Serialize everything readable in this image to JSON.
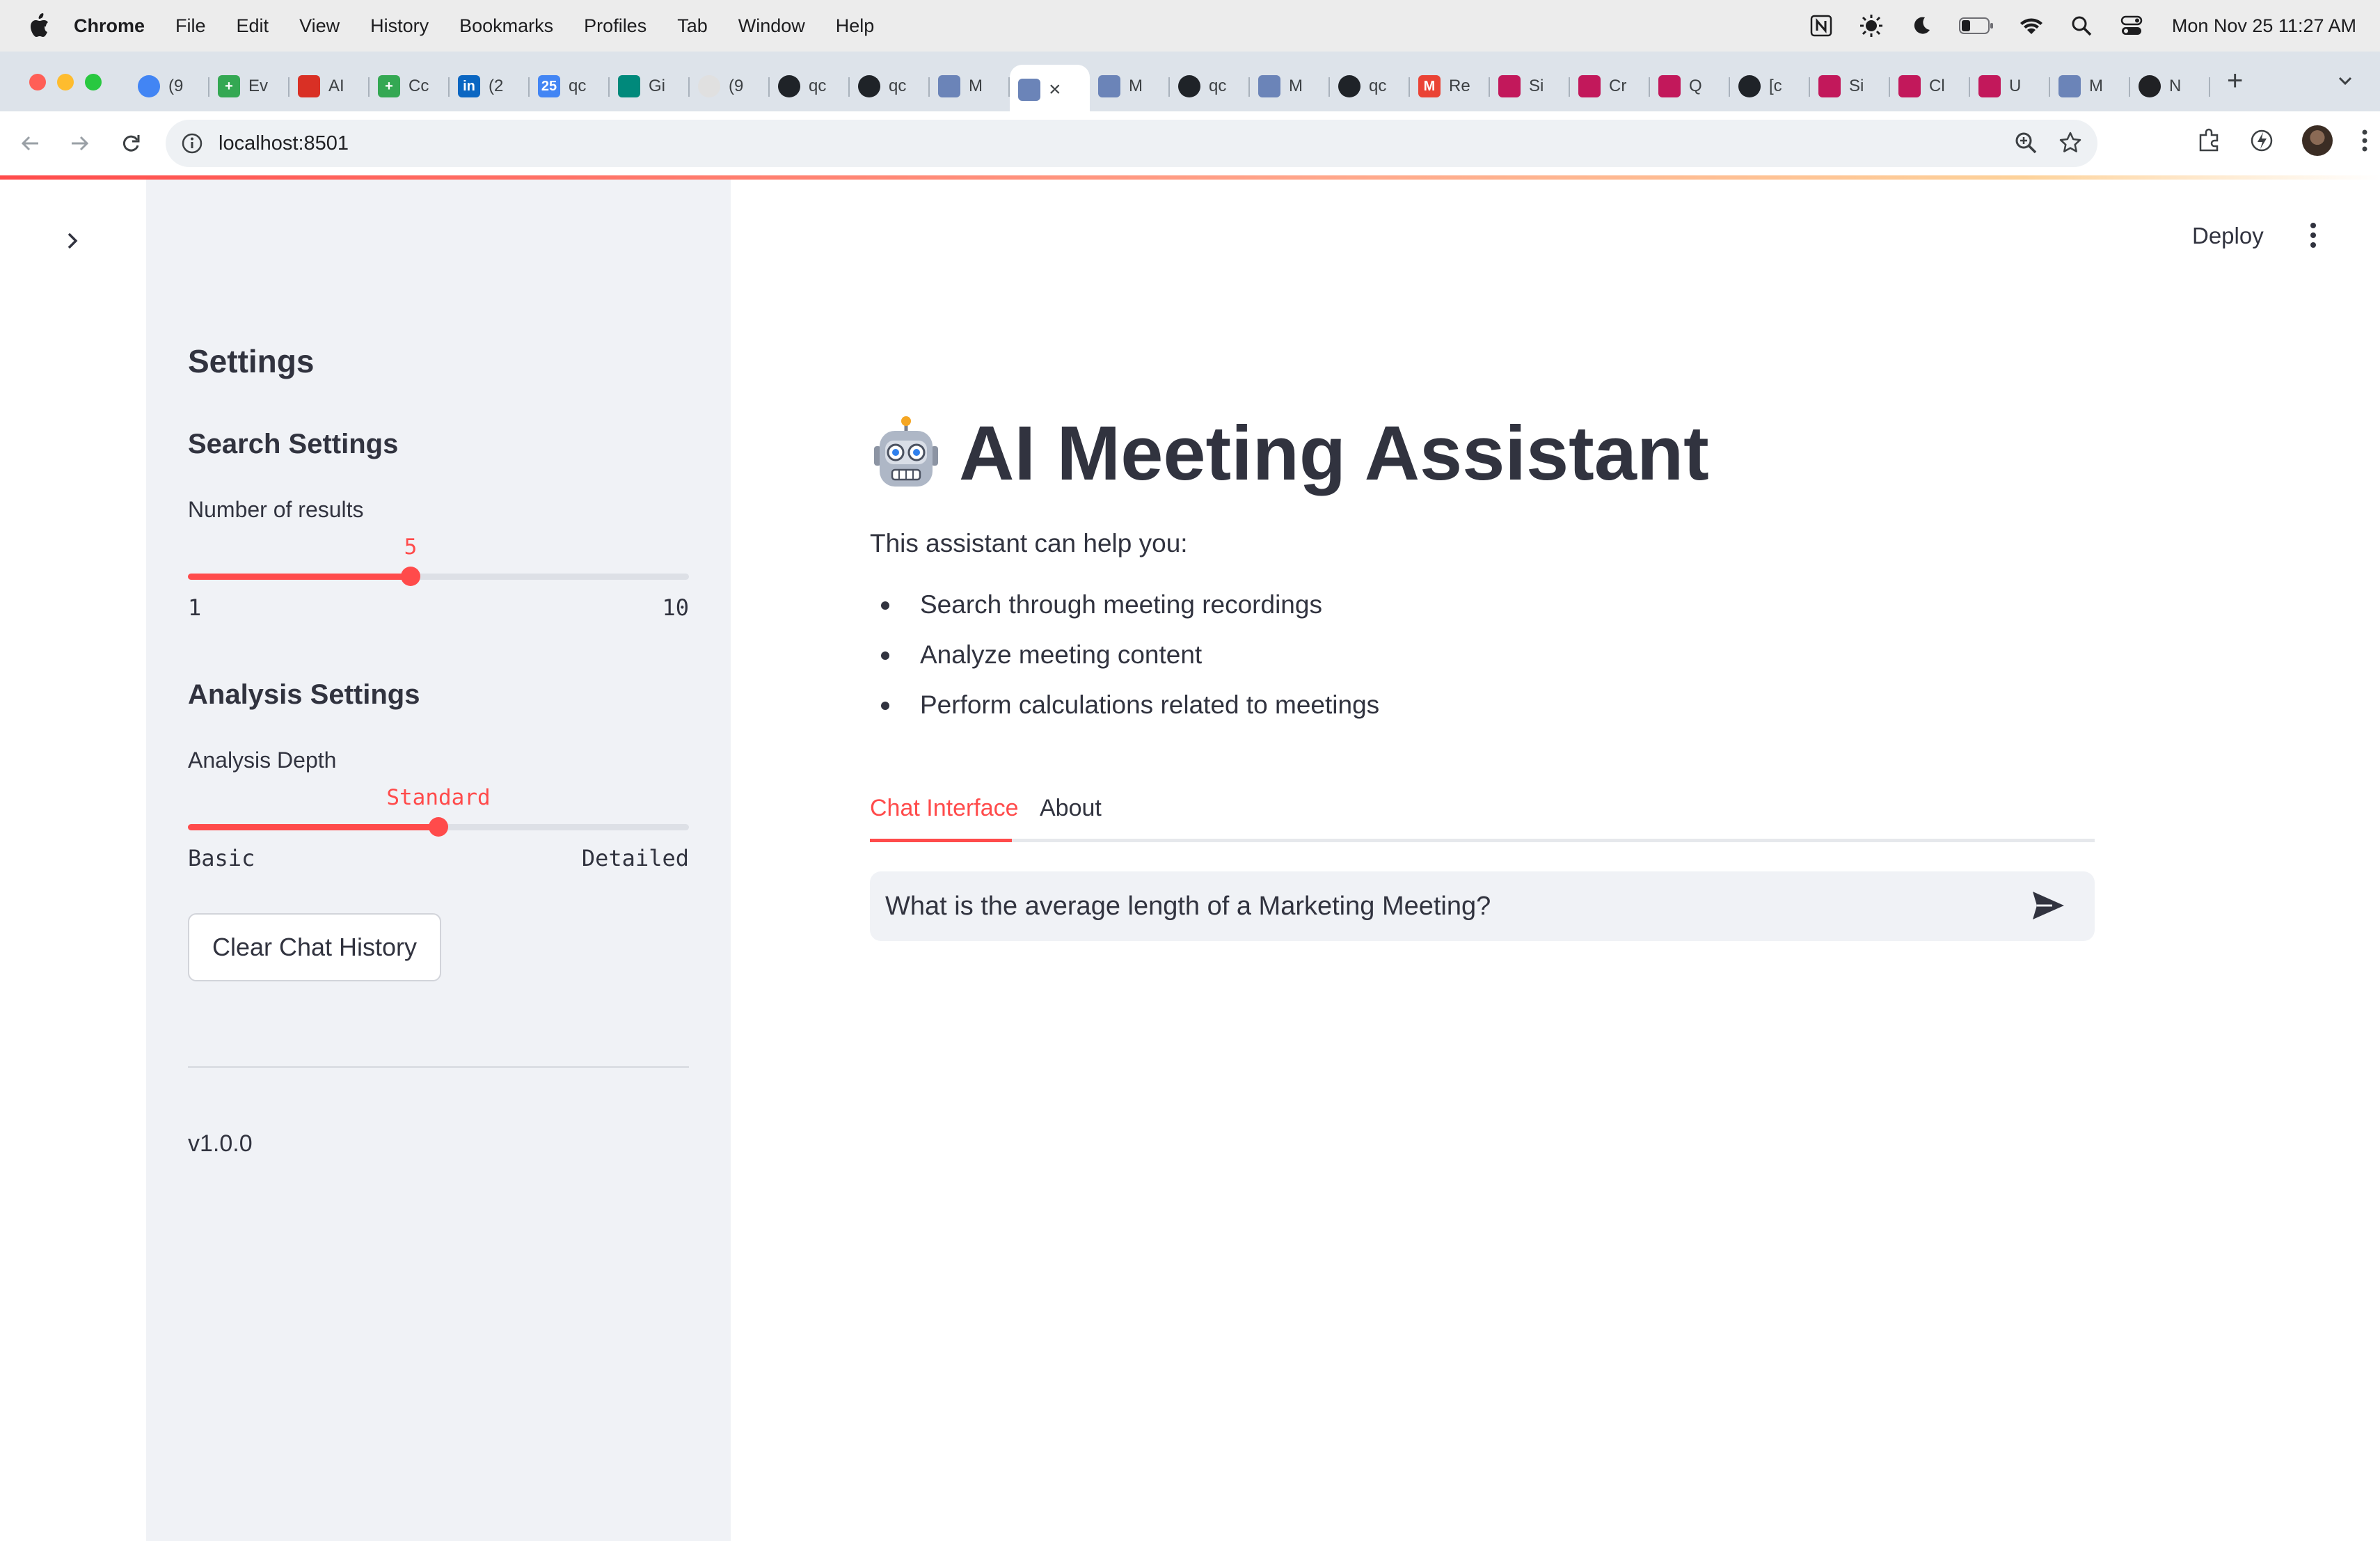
{
  "os_menubar": {
    "app_name": "Chrome",
    "menu_items": [
      "File",
      "Edit",
      "View",
      "History",
      "Bookmarks",
      "Profiles",
      "Tab",
      "Window",
      "Help"
    ],
    "clock": "Mon Nov 25  11:27 AM"
  },
  "browser": {
    "tabs": [
      {
        "label": "(9",
        "icon": "globe-icon",
        "color": "#4285f4"
      },
      {
        "label": "Ev",
        "icon": "sheets-icon",
        "color": "#34a853"
      },
      {
        "label": "AI",
        "icon": "red-app-icon",
        "color": "#d93025"
      },
      {
        "label": "Cc",
        "icon": "sheets-icon",
        "color": "#34a853"
      },
      {
        "label": "(2",
        "icon": "linkedin-icon",
        "color": "#0a66c2"
      },
      {
        "label": "qc",
        "icon": "calendar-icon",
        "color": "#4285f4"
      },
      {
        "label": "Gi",
        "icon": "meet-icon",
        "color": "#00897b"
      },
      {
        "label": "(9",
        "icon": "blank-icon",
        "color": "#e0e0e0"
      },
      {
        "label": "qc",
        "icon": "github-icon",
        "color": "#1f2328"
      },
      {
        "label": "qc",
        "icon": "github-icon",
        "color": "#1f2328"
      },
      {
        "label": "M",
        "icon": "robot-icon",
        "color": "#6b84b8"
      },
      {
        "label": "",
        "icon": "robot-icon",
        "color": "#6b84b8",
        "active": true
      },
      {
        "label": "M",
        "icon": "robot-icon",
        "color": "#6b84b8"
      },
      {
        "label": "qc",
        "icon": "github-icon",
        "color": "#1f2328"
      },
      {
        "label": "M",
        "icon": "robot-icon",
        "color": "#6b84b8"
      },
      {
        "label": "qc",
        "icon": "github-icon",
        "color": "#1f2328"
      },
      {
        "label": "Re",
        "icon": "gmail-icon",
        "color": "#ea4335"
      },
      {
        "label": "Si",
        "icon": "cube-icon",
        "color": "#c2185b"
      },
      {
        "label": "Cr",
        "icon": "cube-icon",
        "color": "#c2185b"
      },
      {
        "label": "Q",
        "icon": "cube-icon",
        "color": "#c2185b"
      },
      {
        "label": "[c",
        "icon": "github-icon",
        "color": "#1f2328"
      },
      {
        "label": "Si",
        "icon": "cube-icon",
        "color": "#c2185b"
      },
      {
        "label": "Cl",
        "icon": "cube-icon",
        "color": "#c2185b"
      },
      {
        "label": "U",
        "icon": "cube-icon",
        "color": "#c2185b"
      },
      {
        "label": "M",
        "icon": "robot-icon",
        "color": "#6b84b8"
      },
      {
        "label": "N",
        "icon": "openai-icon",
        "color": "#202124"
      }
    ],
    "url": "localhost:8501"
  },
  "header": {
    "deploy_label": "Deploy"
  },
  "sidebar": {
    "title": "Settings",
    "search_settings": {
      "heading": "Search Settings",
      "slider_label": "Number of results",
      "value": "5",
      "min": "1",
      "max": "10",
      "fraction": 0.444
    },
    "analysis_settings": {
      "heading": "Analysis Settings",
      "slider_label": "Analysis Depth",
      "value": "Standard",
      "min": "Basic",
      "max": "Detailed",
      "fraction": 0.5
    },
    "clear_button": "Clear Chat History",
    "version": "v1.0.0"
  },
  "main": {
    "title": "AI Meeting Assistant",
    "intro": "This assistant can help you:",
    "bullets": [
      "Search through meeting recordings",
      "Analyze meeting content",
      "Perform calculations related to meetings"
    ],
    "tabs": [
      "Chat Interface",
      "About"
    ],
    "chat_input_value": "What is the average length of a Marketing Meeting?"
  },
  "colors": {
    "accent": "#ff4b4b",
    "sidebar_bg": "#f0f2f6",
    "text": "#31333f"
  }
}
